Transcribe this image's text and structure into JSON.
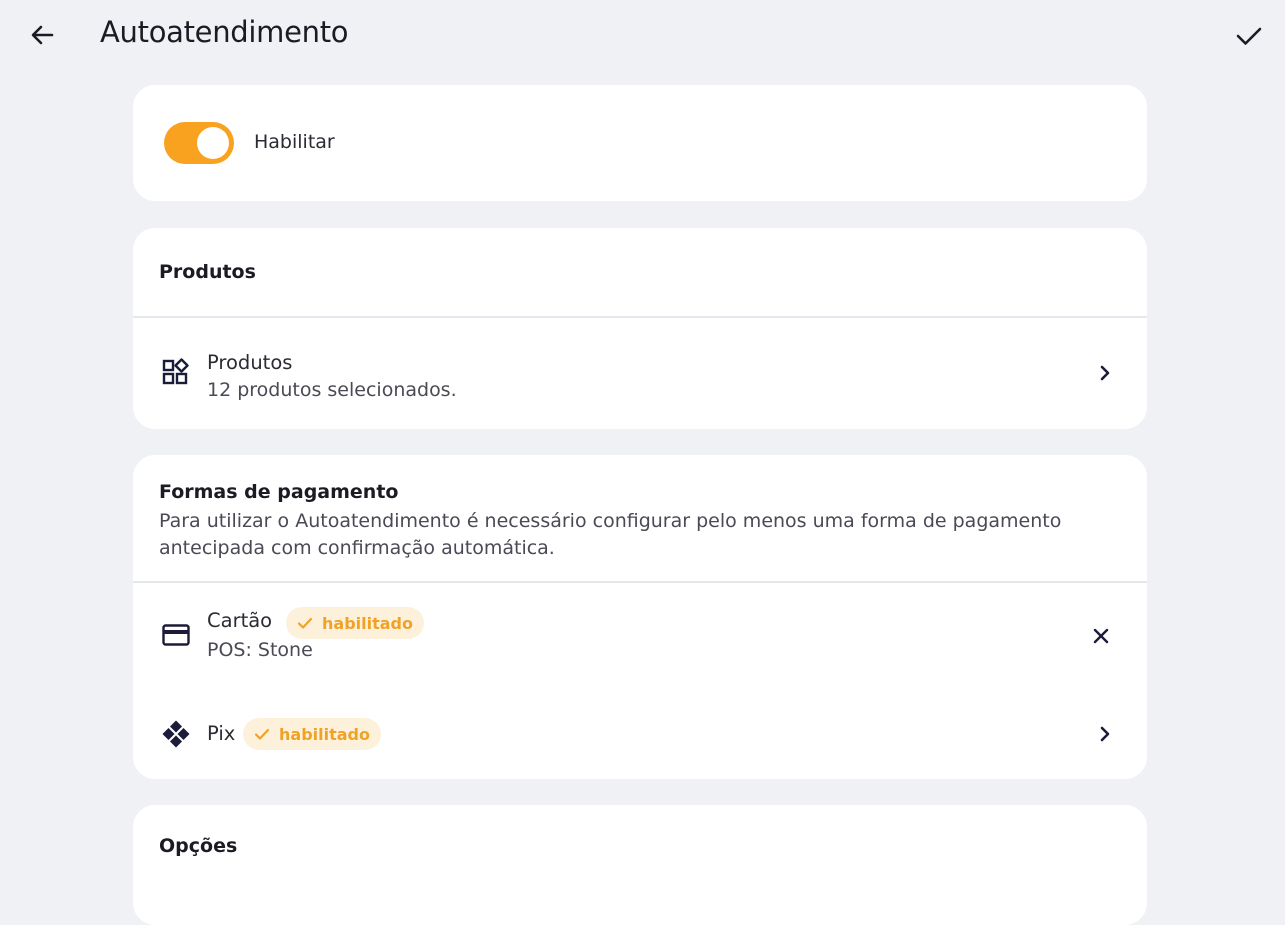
{
  "header": {
    "title": "Autoatendimento"
  },
  "enable": {
    "label": "Habilitar",
    "enabled": true
  },
  "products": {
    "section_title": "Produtos",
    "item": {
      "title": "Produtos",
      "subtitle": "12 produtos selecionados."
    }
  },
  "payment": {
    "section_title": "Formas de pagamento",
    "description": "Para utilizar o Autoatendimento é necessário configurar pelo menos uma forma de pagamento antecipada com confirmação automática.",
    "methods": [
      {
        "title": "Cartão",
        "badge": "habilitado",
        "subtitle": "POS: Stone",
        "icon": "credit-card-icon",
        "action_icon": "close-icon"
      },
      {
        "title": "Pix",
        "badge": "habilitado",
        "icon": "pix-icon",
        "action_icon": "chevron-right-icon"
      }
    ]
  },
  "options": {
    "section_title": "Opções"
  },
  "colors": {
    "accent": "#f9a21f",
    "badge_bg": "#fef1dc",
    "badge_text": "#f0a226",
    "background": "#f0f1f5",
    "card": "#ffffff",
    "icon": "#1b1b3a"
  }
}
